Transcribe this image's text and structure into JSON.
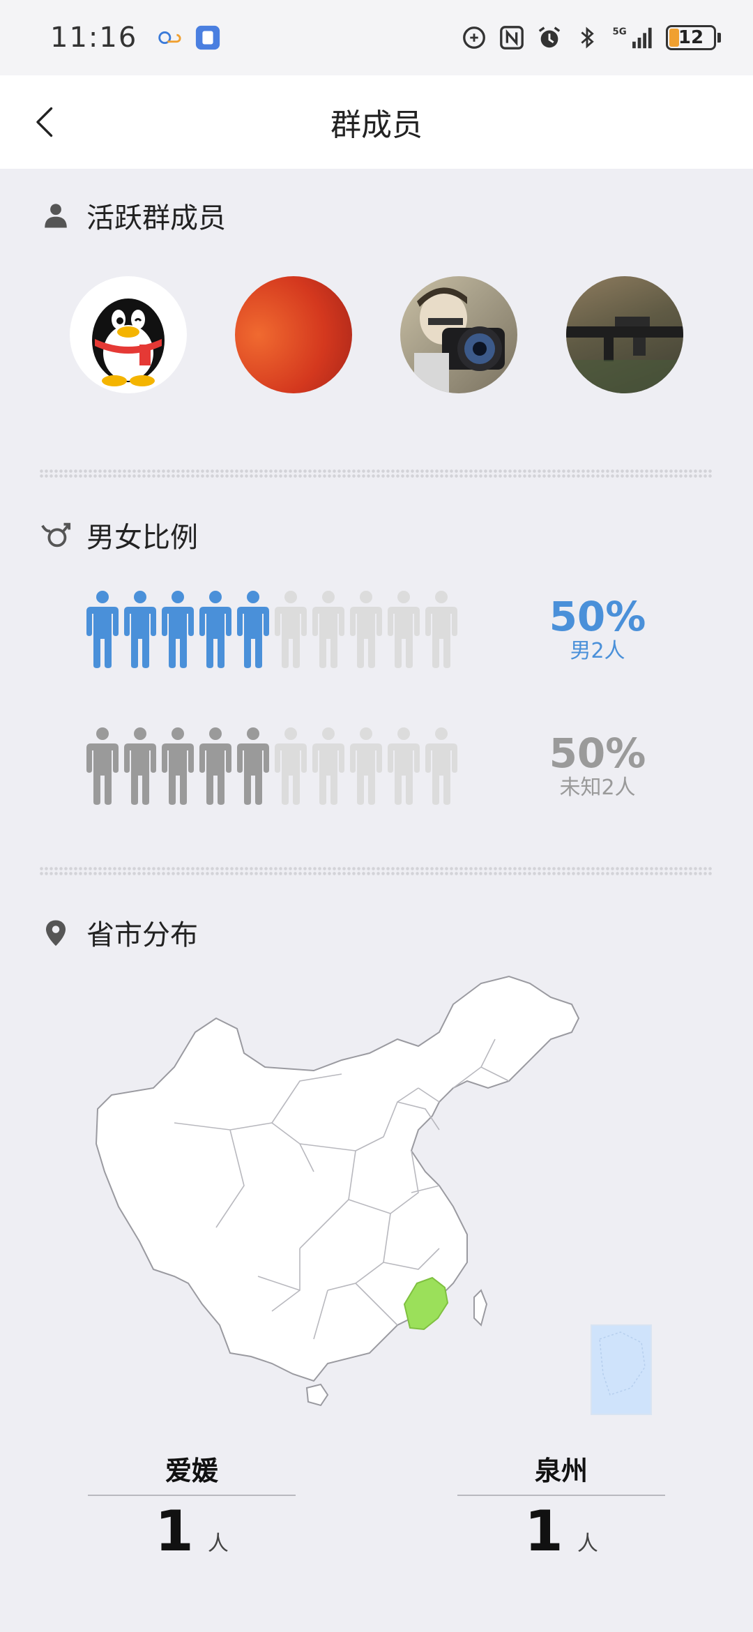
{
  "status_bar": {
    "time": "11:16",
    "battery": "12",
    "network": "5G"
  },
  "header": {
    "title": "群成员"
  },
  "sections": {
    "active_members": "活跃群成员",
    "gender_ratio": "男女比例",
    "region_distribution": "省市分布"
  },
  "avatars": [
    {
      "label": "qq-penguin"
    },
    {
      "label": "orange-gradient"
    },
    {
      "label": "photographer"
    },
    {
      "label": "rifle"
    }
  ],
  "gender": [
    {
      "percent": "50%",
      "sub": "男2人",
      "filled": 5,
      "total": 10,
      "color": "#4a90d9"
    },
    {
      "percent": "50%",
      "sub": "未知2人",
      "filled": 5,
      "total": 10,
      "color": "#9a9a9a"
    }
  ],
  "regions": [
    {
      "name": "爱媛",
      "count": "1",
      "unit": "人"
    },
    {
      "name": "泉州",
      "count": "1",
      "unit": "人"
    }
  ],
  "colors": {
    "male": "#4a90d9",
    "unknown": "#9a9a9a",
    "inactive": "#dcdcdc",
    "highlight_province": "#9be05a"
  }
}
